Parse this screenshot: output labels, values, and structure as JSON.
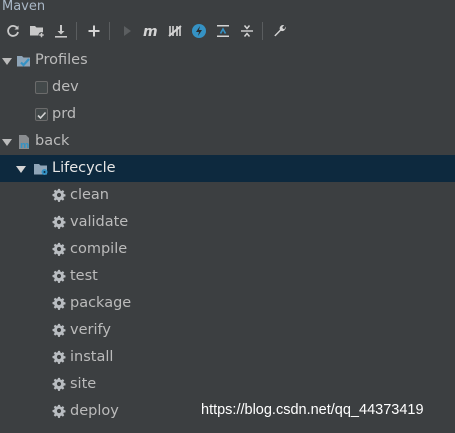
{
  "panel": {
    "title": "Maven"
  },
  "toolbar": {
    "icons": [
      "refresh-icon",
      "add-folder-icon",
      "download-icon",
      "plus-icon",
      "run-icon",
      "m-icon",
      "skip-tests-icon",
      "offline-icon",
      "collapse-icon",
      "expand-icon",
      "wrench-icon"
    ]
  },
  "tree": {
    "profiles": {
      "label": "Profiles",
      "items": [
        {
          "label": "dev",
          "checked": false
        },
        {
          "label": "prd",
          "checked": true
        }
      ]
    },
    "project": {
      "label": "back",
      "lifecycle": {
        "label": "Lifecycle",
        "phases": [
          "clean",
          "validate",
          "compile",
          "test",
          "package",
          "verify",
          "install",
          "site",
          "deploy"
        ]
      }
    }
  },
  "watermark": "https://blog.csdn.net/qq_44373419",
  "colors": {
    "background": "#3c3f41",
    "selection": "#0d293e",
    "text": "#bbbbbb",
    "accent": "#3592c4"
  }
}
